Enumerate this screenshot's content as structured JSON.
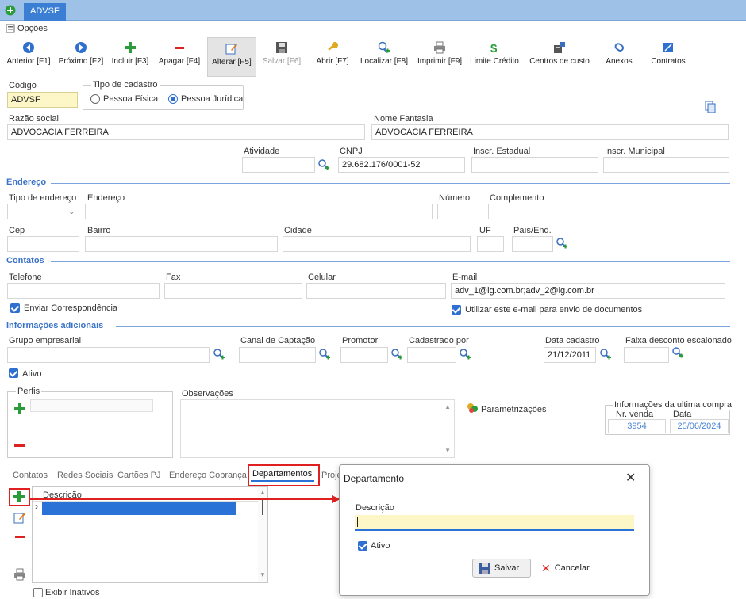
{
  "window": {
    "doc_tab": "ADVSF",
    "options_menu": "Opções"
  },
  "toolbar": [
    {
      "name": "prev-button",
      "label": "Anterior [F1]",
      "icon": "arrow-left-icon"
    },
    {
      "name": "next-button",
      "label": "Próximo [F2]",
      "icon": "arrow-right-icon"
    },
    {
      "name": "add-button",
      "label": "Incluir [F3]",
      "icon": "plus-icon"
    },
    {
      "name": "delete-button",
      "label": "Apagar [F4]",
      "icon": "minus-icon"
    },
    {
      "name": "edit-button",
      "label": "Alterar [F5]",
      "icon": "pencil-icon"
    },
    {
      "name": "save-button",
      "label": "Salvar [F6]",
      "icon": "floppy-icon"
    },
    {
      "name": "open-button",
      "label": "Abrir [F7]",
      "icon": "key-icon"
    },
    {
      "name": "find-button",
      "label": "Localizar [F8]",
      "icon": "magnifier-icon"
    },
    {
      "name": "print-button",
      "label": "Imprimir [F9]",
      "icon": "printer-icon"
    },
    {
      "name": "credit-limit-button",
      "label": "Limite Crédito",
      "icon": "dollar-icon"
    },
    {
      "name": "cost-centers-button",
      "label": "Centros de custo",
      "icon": "cost-center-icon"
    },
    {
      "name": "attachments-button",
      "label": "Anexos",
      "icon": "paperclip-icon"
    },
    {
      "name": "contracts-button",
      "label": "Contratos",
      "icon": "contract-icon"
    }
  ],
  "form": {
    "codigo_label": "Código",
    "codigo_value": "ADVSF",
    "tipo_label": "Tipo de cadastro",
    "pessoa_fisica": "Pessoa Física",
    "pessoa_juridica": "Pessoa Jurídica",
    "razao_label": "Razão social",
    "razao_value": "ADVOCACIA FERREIRA",
    "fantasia_label": "Nome Fantasia",
    "fantasia_value": "ADVOCACIA FERREIRA",
    "atividade_label": "Atividade",
    "cnpj_label": "CNPJ",
    "cnpj_value": "29.682.176/0001-52",
    "ie_label": "Inscr. Estadual",
    "im_label": "Inscr. Municipal"
  },
  "endereco": {
    "section": "Endereço",
    "tipo_label": "Tipo de endereço",
    "endereco_label": "Endereço",
    "numero_label": "Número",
    "complemento_label": "Complemento",
    "cep_label": "Cep",
    "bairro_label": "Bairro",
    "cidade_label": "Cidade",
    "uf_label": "UF",
    "pais_label": "País/End."
  },
  "contatos": {
    "section": "Contatos",
    "telefone_label": "Telefone",
    "fax_label": "Fax",
    "celular_label": "Celular",
    "email_label": "E-mail",
    "email_value": "adv_1@ig.com.br;adv_2@ig.com.br",
    "enviar_corresp": "Enviar Correspondência",
    "usar_email": "Utilizar este e-mail para envio de documentos"
  },
  "info": {
    "section": "Informações adicionais",
    "grupo_label": "Grupo empresarial",
    "canal_label": "Canal de Captação",
    "promotor_label": "Promotor",
    "cadastrado_label": "Cadastrado por",
    "data_cad_label": "Data cadastro",
    "data_cad_value": "21/12/2011",
    "faixa_label": "Faixa desconto escalonado",
    "ativo": "Ativo",
    "perfis_label": "Perfis",
    "obs_label": "Observações",
    "parametrizacoes": "Parametrizações",
    "ultima_compra": "Informações da ultima compra",
    "nr_venda_label": "Nr. venda",
    "nr_venda_value": "3954",
    "data_label": "Data",
    "data_value": "25/06/2024"
  },
  "tabs": [
    "Contatos",
    "Redes Sociais",
    "Cartões PJ",
    "Endereço Cobrança",
    "Departamentos",
    "Proje"
  ],
  "grid": {
    "header": "Descrição",
    "exibir_inativos": "Exibir Inativos"
  },
  "dialog": {
    "title": "Departamento",
    "descricao_label": "Descrição",
    "ativo": "Ativo",
    "save": "Salvar",
    "cancel": "Cancelar"
  },
  "colors": {
    "accent": "#3a72c8",
    "highlight": "#e02020",
    "selection": "#2b72d6",
    "input_focus": "#fdf7c8"
  }
}
